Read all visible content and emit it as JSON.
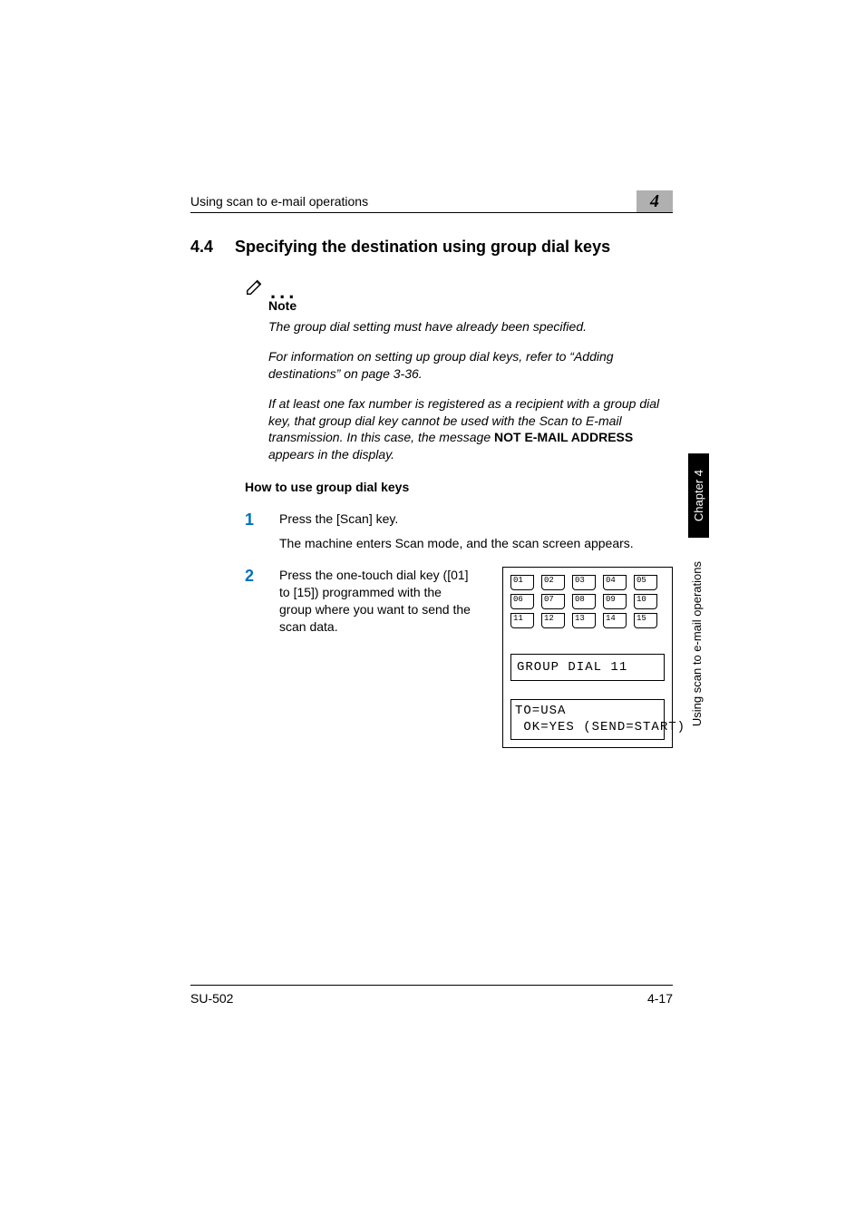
{
  "header": {
    "running_title": "Using scan to e-mail operations",
    "chapter_number": "4"
  },
  "section": {
    "number": "4.4",
    "title": "Specifying the destination using group dial keys"
  },
  "note": {
    "label": "Note",
    "p1": "The group dial setting must have already been specified.",
    "p2": "For information on setting up group dial keys, refer to “Adding destinations” on page 3-36.",
    "p3_pre": "If at least one fax number is registered as a recipient with a group dial key, that group dial key cannot be used with the Scan to E-mail transmission. In this case, the message ",
    "p3_bold": "NOT E-MAIL ADDRESS",
    "p3_post": " appears in the display."
  },
  "howto_heading": "How to use group dial keys",
  "steps": [
    {
      "num": "1",
      "text": "Press the [Scan] key.",
      "sub": "The machine enters Scan mode, and the scan screen appears."
    },
    {
      "num": "2",
      "text": "Press the one-touch dial key ([01] to [15]) programmed with the group where you want to send the scan data."
    }
  ],
  "keypad": {
    "rows": [
      [
        "01",
        "02",
        "03",
        "04",
        "05"
      ],
      [
        "06",
        "07",
        "08",
        "09",
        "10"
      ],
      [
        "11",
        "12",
        "13",
        "14",
        "15"
      ]
    ],
    "lcd1": "GROUP DIAL 11",
    "lcd2": "TO=USA\n OK=YES (SEND=START)"
  },
  "side": {
    "tab": "Chapter 4",
    "text": "Using scan to e-mail operations"
  },
  "footer": {
    "left": "SU-502",
    "right": "4-17"
  }
}
